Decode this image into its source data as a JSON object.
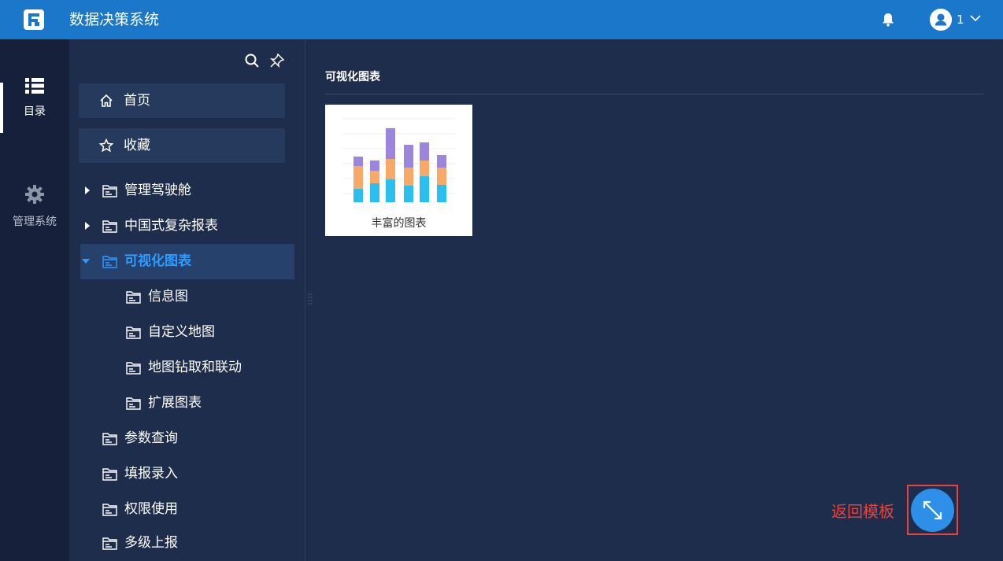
{
  "app": {
    "title": "数据决策系统"
  },
  "header": {
    "username": "1"
  },
  "rail": {
    "items": [
      {
        "label": "目录",
        "icon": "list-icon",
        "active": true
      },
      {
        "label": "管理系统",
        "icon": "gear-icon",
        "active": false
      }
    ]
  },
  "directory": {
    "quick_links": [
      {
        "label": "首页",
        "icon": "home-icon"
      },
      {
        "label": "收藏",
        "icon": "star-icon"
      }
    ],
    "tree": [
      {
        "label": "管理驾驶舱",
        "level": 0,
        "expandable": true,
        "expanded": false
      },
      {
        "label": "中国式复杂报表",
        "level": 0,
        "expandable": true,
        "expanded": false
      },
      {
        "label": "可视化图表",
        "level": 0,
        "expandable": true,
        "expanded": true,
        "active": true
      },
      {
        "label": "信息图",
        "level": 1
      },
      {
        "label": "自定义地图",
        "level": 1
      },
      {
        "label": "地图钻取和联动",
        "level": 1
      },
      {
        "label": "扩展图表",
        "level": 1
      },
      {
        "label": "参数查询",
        "level": 0
      },
      {
        "label": "填报录入",
        "level": 0
      },
      {
        "label": "权限使用",
        "level": 0
      },
      {
        "label": "多级上报",
        "level": 0
      }
    ]
  },
  "content": {
    "section_title": "可视化图表",
    "cards": [
      {
        "label": "丰富的图表"
      }
    ]
  },
  "annotation": {
    "return_label": "返回模板"
  },
  "colors": {
    "topbar": "#1b77c9",
    "rail": "#16203a",
    "panel": "#1f2d4d",
    "active_text": "#2e9bff",
    "annotation_red": "#e5453d",
    "thumb_purple": "#9b85dd",
    "thumb_orange": "#f8a867",
    "thumb_cyan": "#2bbff0"
  }
}
